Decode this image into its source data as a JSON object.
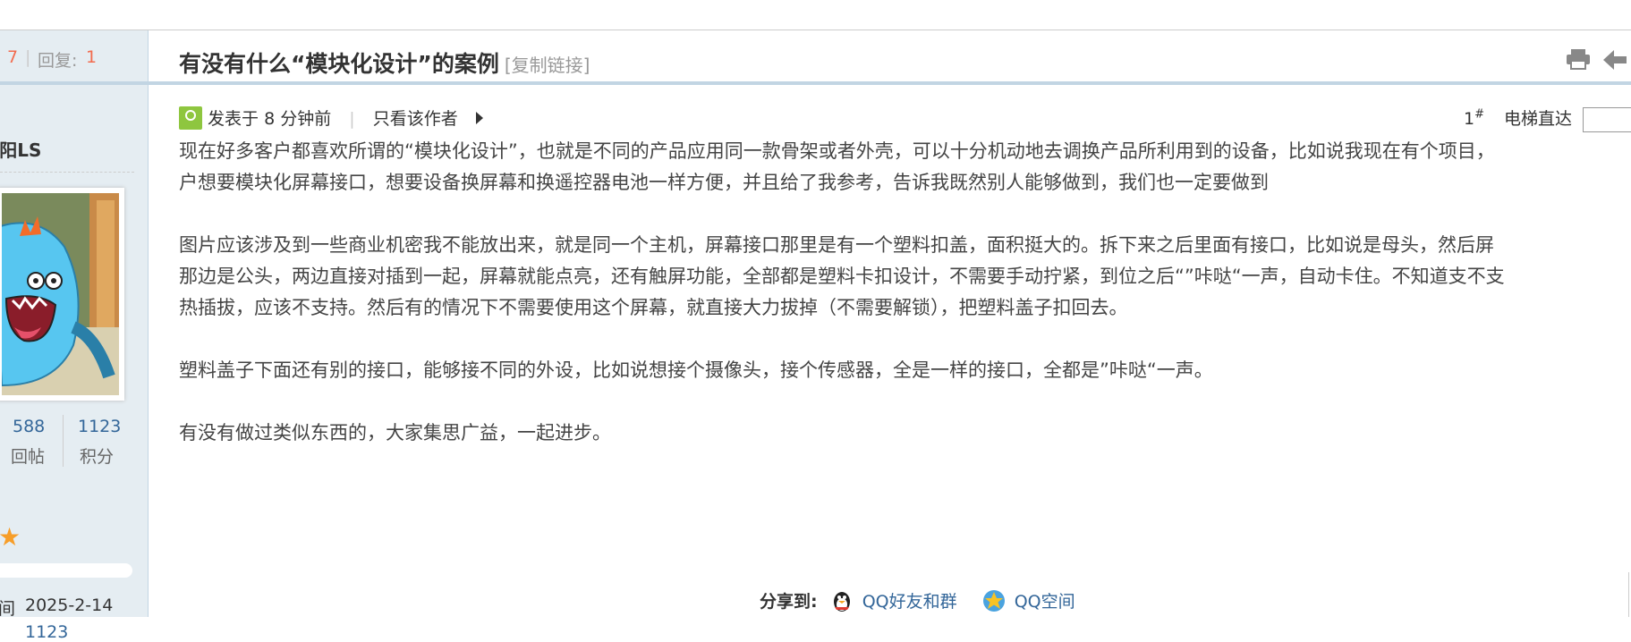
{
  "sidebar": {
    "views": "7",
    "replies_label": "回复:",
    "replies": "1",
    "username": "k阳LS",
    "posts_count": "588",
    "posts_label": "回帖",
    "points_count": "1123",
    "points_label": "积分",
    "star": "★",
    "time_label": "间",
    "date": "2025-2-14",
    "points_value": "1123"
  },
  "thread": {
    "title": "有没有什么“模块化设计”的案例",
    "copy_link": "[复制链接]"
  },
  "post_meta": {
    "posted": "发表于 8 分钟前",
    "pipe": "|",
    "only_author": "只看该作者",
    "floor": "1",
    "floor_mark": "#",
    "elevator": "电梯直达"
  },
  "content": {
    "p1_l1": "现在好多客户都喜欢所谓的“模块化设计”，也就是不同的产品应用同一款骨架或者外壳，可以十分机动地去调换产品所利用到的设备，比如说我现在有个项目，",
    "p1_l2": "户想要模块化屏幕接口，想要设备换屏幕和换遥控器电池一样方便，并且给了我参考，告诉我既然别人能够做到，我们也一定要做到",
    "p2_l1": "图片应该涉及到一些商业机密我不能放出来，就是同一个主机，屏幕接口那里是有一个塑料扣盖，面积挺大的。拆下来之后里面有接口，比如说是母头，然后屏",
    "p2_l2": "那边是公头，两边直接对插到一起，屏幕就能点亮，还有触屏功能，全部都是塑料卡扣设计，不需要手动拧紧，到位之后“”咔哒“一声，自动卡住。不知道支不支",
    "p2_l3": "热插拔，应该不支持。然后有的情况下不需要使用这个屏幕，就直接大力拔掉（不需要解锁），把塑料盖子扣回去。",
    "p3": "塑料盖子下面还有别的接口，能够接不同的外设，比如说想接个摄像头，接个传感器，全是一样的接口，全都是”咔哒“一声。",
    "p4": "有没有做过类似东西的，大家集思广益，一起进步。"
  },
  "share": {
    "label": "分享到:",
    "qq_friends": "QQ好友和群",
    "qq_zone": "QQ空间"
  },
  "colors": {
    "sidebar_bg": "#e5edf2",
    "border_blue": "#c2d5e3",
    "link_blue": "#336699",
    "accent_red": "#f26c4f",
    "star_orange": "#f79e29"
  }
}
